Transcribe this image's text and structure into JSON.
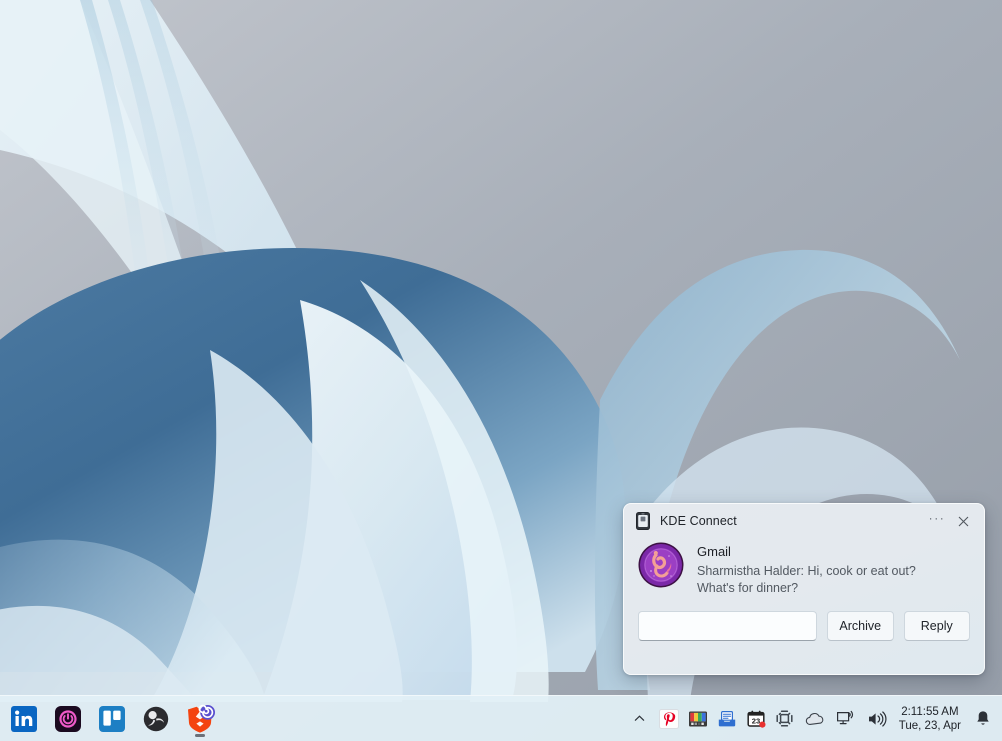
{
  "desktop": {
    "wallpaper_name": "windows-bloom-wallpaper",
    "bg_color": "#9aa2ac",
    "ribbon_light": "#dfeaf2",
    "ribbon_mid": "#b7d0e0",
    "ribbon_dark": "#3d6c96"
  },
  "toast": {
    "app_icon_name": "smartphone-icon",
    "app_title": "KDE Connect",
    "more_label": "···",
    "close_label": "×",
    "avatar_name": "capricorn-avatar",
    "notification_title": "Gmail",
    "notification_body": "Sharmistha Halder: Hi, cook or eat out? What's for dinner?",
    "reply_input_value": "",
    "reply_input_placeholder": "",
    "archive_label": "Archive",
    "reply_label": "Reply",
    "bg_color": "#e4e9ee"
  },
  "taskbar": {
    "bg_color": "#e2f0f6",
    "apps": [
      {
        "name": "linkedin",
        "label": "LinkedIn",
        "running": false
      },
      {
        "name": "opera-gx",
        "label": "Opera GX",
        "running": false
      },
      {
        "name": "trello",
        "label": "Trello",
        "running": false
      },
      {
        "name": "obs-studio",
        "label": "OBS Studio",
        "running": false
      },
      {
        "name": "brave-browser",
        "label": "Brave",
        "running": true
      }
    ],
    "tray": [
      {
        "name": "show-hidden-icons",
        "label": "Show hidden icons"
      },
      {
        "name": "pinterest",
        "label": "Pinterest"
      },
      {
        "name": "color-palette",
        "label": "Color palette"
      },
      {
        "name": "mail-tray",
        "label": "Mail"
      },
      {
        "name": "calendar",
        "label": "Calendar",
        "badge": "23"
      },
      {
        "name": "slack",
        "label": "Slack"
      },
      {
        "name": "onedrive-cloud",
        "label": "OneDrive"
      },
      {
        "name": "network",
        "label": "Network"
      },
      {
        "name": "volume",
        "label": "Volume"
      }
    ],
    "clock": {
      "time": "2:11:55 AM",
      "date": "Tue, 23, Apr"
    },
    "notification_bell_name": "notification-bell-icon"
  }
}
